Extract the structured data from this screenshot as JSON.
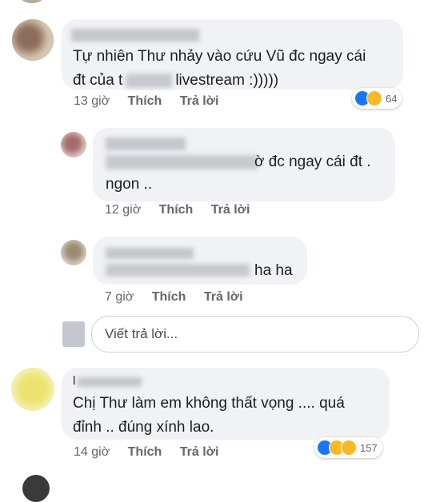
{
  "comments": [
    {
      "text_line1": "Tự nhiên Thư nhảy vào cứu Vũ đc ngay cái",
      "text_line2_start": "đt của t",
      "text_line2_end": "livestream :)))))",
      "time": "13 giờ",
      "like_label": "Thích",
      "reply_label": "Trả lời",
      "reaction_count": "64",
      "reactions": [
        "like-icon",
        "haha-icon"
      ]
    },
    {
      "text_line1_end": "ờ đc ngay cái đt .",
      "text_line2": "ngon ..",
      "time": "12 giờ",
      "like_label": "Thích",
      "reply_label": "Trả lời"
    },
    {
      "text_end": "ha ha",
      "time": "7 giờ",
      "like_label": "Thích",
      "reply_label": "Trả lời"
    },
    {
      "name_fragment": "l",
      "text_line1": "Chị Thư làm em không thất vọng .... quá",
      "text_line2": "đỉnh .. đúng xính lao.",
      "time": "14 giờ",
      "like_label": "Thích",
      "reply_label": "Trả lời",
      "reaction_count": "157",
      "reactions": [
        "like-icon",
        "haha-icon",
        "sad-icon"
      ]
    }
  ],
  "reply_box": {
    "placeholder": "Viết trả lời..."
  },
  "colors": {
    "bubble": "#f0f2f5",
    "meta": "#65676b",
    "like": "#1877f2",
    "haha": "#f7b928"
  }
}
